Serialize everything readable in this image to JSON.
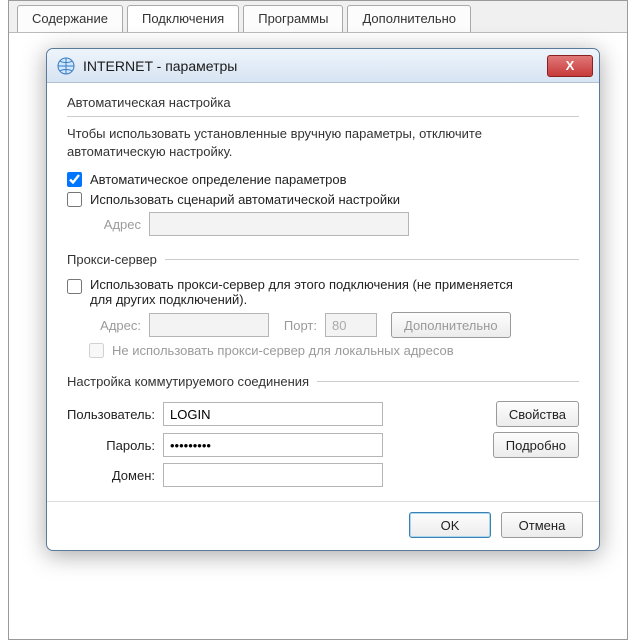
{
  "bg_tabs": [
    "Содержание",
    "Подключения",
    "Программы",
    "Дополнительно"
  ],
  "bg_active_tab": 1,
  "modal": {
    "title": "INTERNET - параметры",
    "close_glyph": "X",
    "auto": {
      "heading": "Автоматическая настройка",
      "desc": "Чтобы использовать установленные вручную параметры, отключите автоматическую настройку.",
      "cb_autodetect": "Автоматическое определение параметров",
      "cb_autodetect_checked": true,
      "cb_script": "Использовать сценарий автоматической настройки",
      "cb_script_checked": false,
      "addr_label": "Адрес",
      "addr_value": ""
    },
    "proxy": {
      "heading": "Прокси-сервер",
      "cb_use": "Использовать прокси-сервер для этого подключения (не применяется для других подключений).",
      "cb_use_checked": false,
      "addr_label": "Адрес:",
      "addr_value": "",
      "port_label": "Порт:",
      "port_value": "80",
      "adv_label": "Дополнительно",
      "cb_bypass": "Не использовать прокси-сервер для локальных адресов",
      "cb_bypass_checked": false
    },
    "dial": {
      "heading": "Настройка коммутируемого соединения",
      "user_label": "Пользователь:",
      "user_value": "LOGIN",
      "pass_label": "Пароль:",
      "pass_value": "password1",
      "domain_label": "Домен:",
      "domain_value": "",
      "props_label": "Свойства",
      "details_label": "Подробно"
    },
    "ok_label": "OK",
    "cancel_label": "Отмена"
  }
}
